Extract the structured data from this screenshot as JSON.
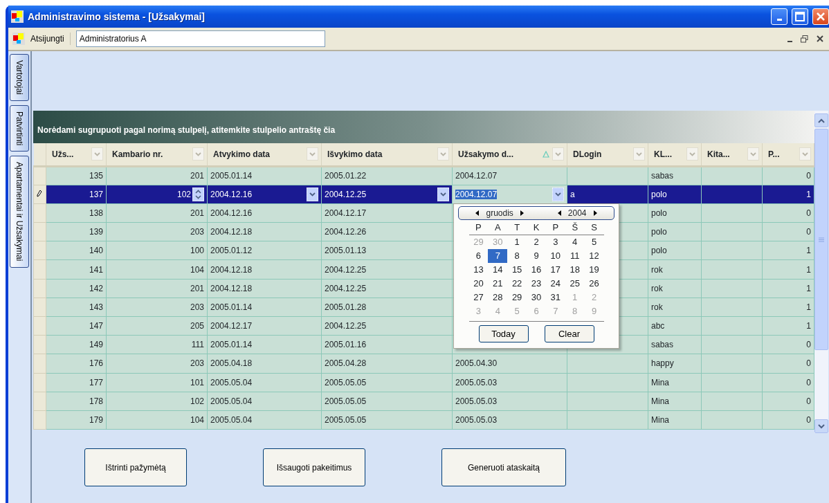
{
  "window": {
    "title": "Administravimo sistema - [Užsakymai]"
  },
  "toolbar": {
    "logout": "Atsijungti",
    "user": "Administratorius A"
  },
  "side_tabs": [
    {
      "label": "Vartotojai",
      "selected": false
    },
    {
      "label": "Patvirtinti",
      "selected": false
    },
    {
      "label": "Apartamentai ir Užsakymai",
      "selected": true
    }
  ],
  "grid": {
    "group_hint": "Norėdami sugrupuoti pagal norimą stulpelį, atitemkite stulpelio antraštę čia",
    "columns": [
      {
        "label": "Užs...",
        "focused": false,
        "sorted": false
      },
      {
        "label": "Kambario nr.",
        "focused": false,
        "sorted": false
      },
      {
        "label": "Atvykimo data",
        "focused": false,
        "sorted": false
      },
      {
        "label": "Išvykimo data",
        "focused": false,
        "sorted": false
      },
      {
        "label": "Užsakymo d...",
        "focused": true,
        "sorted": true
      },
      {
        "label": "DLogin",
        "focused": false,
        "sorted": false
      },
      {
        "label": "KL...",
        "focused": false,
        "sorted": false
      },
      {
        "label": "Kita...",
        "focused": false,
        "sorted": false
      },
      {
        "label": "P...",
        "focused": false,
        "sorted": false
      }
    ],
    "rows": [
      {
        "selected": false,
        "cells": [
          "135",
          "201",
          "2005.01.14",
          "2005.01.22",
          "2004.12.07",
          null,
          "sabas",
          null,
          "0"
        ]
      },
      {
        "selected": true,
        "cells": [
          "137",
          "102",
          "2004.12.16",
          "2004.12.25",
          "2004.12.07",
          "a",
          "polo",
          null,
          "1"
        ]
      },
      {
        "selected": false,
        "cells": [
          "138",
          "201",
          "2004.12.16",
          "2004.12.17",
          null,
          null,
          "polo",
          null,
          "0"
        ]
      },
      {
        "selected": false,
        "cells": [
          "139",
          "203",
          "2004.12.18",
          "2004.12.26",
          null,
          null,
          "polo",
          null,
          "0"
        ]
      },
      {
        "selected": false,
        "cells": [
          "140",
          "100",
          "2005.01.12",
          "2005.01.13",
          null,
          null,
          "polo",
          null,
          "1"
        ]
      },
      {
        "selected": false,
        "cells": [
          "141",
          "104",
          "2004.12.18",
          "2004.12.25",
          null,
          null,
          "rok",
          null,
          "1"
        ]
      },
      {
        "selected": false,
        "cells": [
          "142",
          "201",
          "2004.12.18",
          "2004.12.25",
          null,
          null,
          "rok",
          null,
          "1"
        ]
      },
      {
        "selected": false,
        "cells": [
          "143",
          "203",
          "2005.01.14",
          "2005.01.28",
          null,
          null,
          "rok",
          null,
          "1"
        ]
      },
      {
        "selected": false,
        "cells": [
          "147",
          "205",
          "2004.12.17",
          "2004.12.25",
          null,
          null,
          "abc",
          null,
          "1"
        ]
      },
      {
        "selected": false,
        "cells": [
          "149",
          "111",
          "2005.01.14",
          "2005.01.16",
          null,
          null,
          "sabas",
          null,
          "0"
        ]
      },
      {
        "selected": false,
        "cells": [
          "176",
          "203",
          "2005.04.18",
          "2005.04.28",
          "2005.04.30",
          null,
          "happy",
          null,
          "0"
        ]
      },
      {
        "selected": false,
        "cells": [
          "177",
          "101",
          "2005.05.04",
          "2005.05.05",
          "2005.05.03",
          null,
          "Mina",
          null,
          "0"
        ]
      },
      {
        "selected": false,
        "cells": [
          "178",
          "102",
          "2005.05.04",
          "2005.05.05",
          "2005.05.03",
          null,
          "Mina",
          null,
          "0"
        ]
      },
      {
        "selected": false,
        "cells": [
          "179",
          "104",
          "2005.05.04",
          "2005.05.05",
          "2005.05.03",
          null,
          "Mina",
          null,
          "0"
        ]
      }
    ]
  },
  "calendar": {
    "month": "gruodis",
    "year": "2004",
    "weekdays": [
      "P",
      "A",
      "T",
      "K",
      "P",
      "Š",
      "S"
    ],
    "days": [
      {
        "d": "29",
        "muted": true,
        "selected": false
      },
      {
        "d": "30",
        "muted": true,
        "selected": false
      },
      {
        "d": "1",
        "muted": false,
        "selected": false
      },
      {
        "d": "2",
        "muted": false,
        "selected": false
      },
      {
        "d": "3",
        "muted": false,
        "selected": false
      },
      {
        "d": "4",
        "muted": false,
        "selected": false
      },
      {
        "d": "5",
        "muted": false,
        "selected": false
      },
      {
        "d": "6",
        "muted": false,
        "selected": false
      },
      {
        "d": "7",
        "muted": false,
        "selected": true
      },
      {
        "d": "8",
        "muted": false,
        "selected": false
      },
      {
        "d": "9",
        "muted": false,
        "selected": false
      },
      {
        "d": "10",
        "muted": false,
        "selected": false
      },
      {
        "d": "11",
        "muted": false,
        "selected": false
      },
      {
        "d": "12",
        "muted": false,
        "selected": false
      },
      {
        "d": "13",
        "muted": false,
        "selected": false
      },
      {
        "d": "14",
        "muted": false,
        "selected": false
      },
      {
        "d": "15",
        "muted": false,
        "selected": false
      },
      {
        "d": "16",
        "muted": false,
        "selected": false
      },
      {
        "d": "17",
        "muted": false,
        "selected": false
      },
      {
        "d": "18",
        "muted": false,
        "selected": false
      },
      {
        "d": "19",
        "muted": false,
        "selected": false
      },
      {
        "d": "20",
        "muted": false,
        "selected": false
      },
      {
        "d": "21",
        "muted": false,
        "selected": false
      },
      {
        "d": "22",
        "muted": false,
        "selected": false
      },
      {
        "d": "23",
        "muted": false,
        "selected": false
      },
      {
        "d": "24",
        "muted": false,
        "selected": false
      },
      {
        "d": "25",
        "muted": false,
        "selected": false
      },
      {
        "d": "26",
        "muted": false,
        "selected": false
      },
      {
        "d": "27",
        "muted": false,
        "selected": false
      },
      {
        "d": "28",
        "muted": false,
        "selected": false
      },
      {
        "d": "29",
        "muted": false,
        "selected": false
      },
      {
        "d": "30",
        "muted": false,
        "selected": false
      },
      {
        "d": "31",
        "muted": false,
        "selected": false
      },
      {
        "d": "1",
        "muted": true,
        "selected": false
      },
      {
        "d": "2",
        "muted": true,
        "selected": false
      },
      {
        "d": "3",
        "muted": true,
        "selected": false
      },
      {
        "d": "4",
        "muted": true,
        "selected": false
      },
      {
        "d": "5",
        "muted": true,
        "selected": false
      },
      {
        "d": "6",
        "muted": true,
        "selected": false
      },
      {
        "d": "7",
        "muted": true,
        "selected": false
      },
      {
        "d": "8",
        "muted": true,
        "selected": false
      },
      {
        "d": "9",
        "muted": true,
        "selected": false
      }
    ],
    "buttons": [
      "Today",
      "Clear"
    ]
  },
  "buttons": [
    "Ištrinti pažymėtą",
    "Išsaugoti pakeitimus",
    "Generuoti ataskaitą"
  ]
}
